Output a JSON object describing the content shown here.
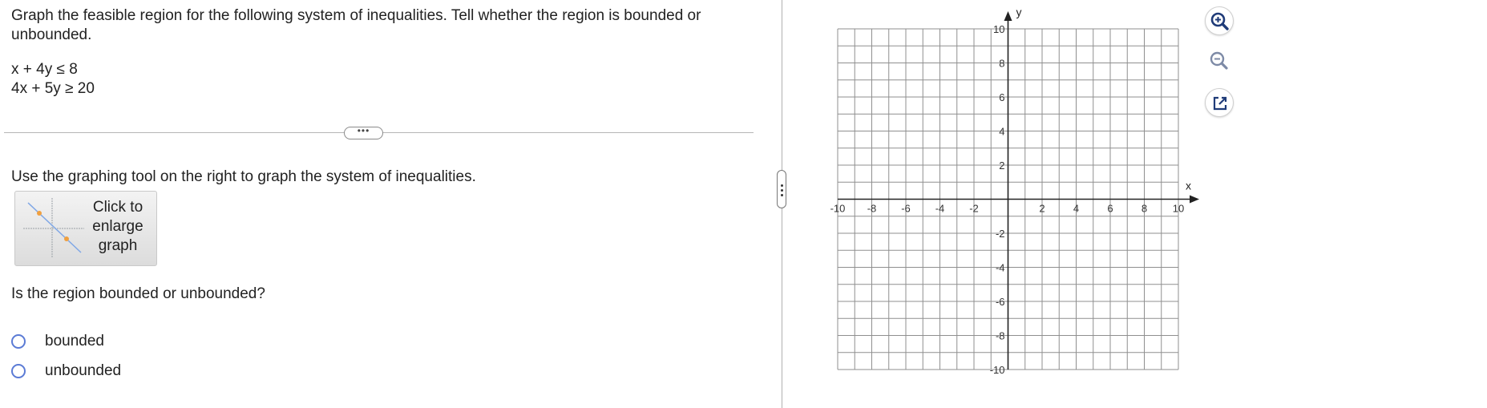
{
  "problem": {
    "instruction_line1": "Graph the feasible region for the following system of inequalities. Tell whether the region is bounded or",
    "instruction_line2": "unbounded.",
    "inequality1": "x + 4y ≤ 8",
    "inequality2": "4x + 5y ≥ 20"
  },
  "more_button_label": "•••",
  "tool_instruction": "Use the graphing tool on the right to graph the system of inequalities.",
  "enlarge_button": {
    "line1": "Click to",
    "line2": "enlarge",
    "line3": "graph"
  },
  "question": "Is the region bounded or unbounded?",
  "options": [
    {
      "label": "bounded",
      "selected": false
    },
    {
      "label": "unbounded",
      "selected": false
    }
  ],
  "graph": {
    "x_axis_label": "x",
    "y_axis_label": "y",
    "x_range": [
      -10,
      10
    ],
    "y_range": [
      -10,
      10
    ],
    "grid_step": 1,
    "x_tick_labels": [
      "-10",
      "-8",
      "-6",
      "-4",
      "-2",
      "2",
      "4",
      "6",
      "8",
      "10"
    ],
    "y_tick_labels": [
      "10",
      "8",
      "6",
      "4",
      "2",
      "-2",
      "-4",
      "-6",
      "-8",
      "-10"
    ]
  },
  "tools": [
    "zoom-in-icon",
    "zoom-out-icon",
    "external-link-icon"
  ],
  "colors": {
    "radio_border": "#5b7bd5",
    "tool_icon": "#1f3b78",
    "grid": "#8f8f8f"
  }
}
